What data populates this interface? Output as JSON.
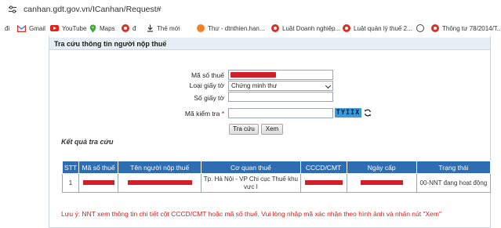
{
  "browser": {
    "url": "canhan.gdt.gov.vn/ICanhan/Request#"
  },
  "bookmarks": [
    {
      "label": "đi",
      "icon": "none"
    },
    {
      "label": "Gmail",
      "icon": "gmail-icon"
    },
    {
      "label": "YouTube",
      "icon": "youtube-icon"
    },
    {
      "label": "Maps",
      "icon": "maps-icon"
    },
    {
      "label": "đ",
      "icon": "red-circle-icon"
    },
    {
      "label": "Thẻ mới",
      "icon": "download-icon"
    },
    {
      "label": "Thư - dtnthien.han...",
      "icon": "orange-circle-icon"
    },
    {
      "label": "Luật Doanh nghiệp...",
      "icon": "red-circle-icon"
    },
    {
      "label": "Luật quản lý thuế 2...",
      "icon": "red-circle-icon"
    },
    {
      "label": "",
      "icon": "globe-icon"
    },
    {
      "label": "Thông tư 78/2014/T...",
      "icon": "red-circle-icon"
    }
  ],
  "panel": {
    "title": "Tra cứu thông tin người nộp thuế"
  },
  "form": {
    "tax_code_label": "Mã số thuế",
    "doc_type_label": "Loại giấy tờ",
    "doc_type_value": "Chứng minh thư",
    "doc_number_label": "Số giấy tờ",
    "captcha_label": "Mã kiểm tra",
    "required_mark": "*",
    "captcha_text": "TYIIX",
    "search_button": "Tra cứu",
    "view_button": "Xem"
  },
  "results": {
    "title": "Kết quả tra cứu",
    "columns": [
      "STT",
      "Mã số thuế",
      "Tên người nộp thuế",
      "Cơ quan thuế",
      "CCCD/CMT",
      "Ngày cấp",
      "Trạng thái"
    ],
    "rows": [
      {
        "stt": "1",
        "tax_authority": "Tp. Hà Nội - VP Chi cục Thuế khu vực I",
        "status": "00-NNT đang hoạt động"
      }
    ]
  },
  "note": "Lưu ý: NNT xem thông tin chi tiết cột CCCD/CMT hoặc mã số thuế. Vui lòng nhập mã xác nhận theo hình ảnh và nhấn nút \"Xem\"",
  "colors": {
    "table_header": "#2f6db2",
    "note_text": "#d0211c",
    "captcha_bg": "#3b9ad9",
    "redaction": "#d01f2a"
  }
}
